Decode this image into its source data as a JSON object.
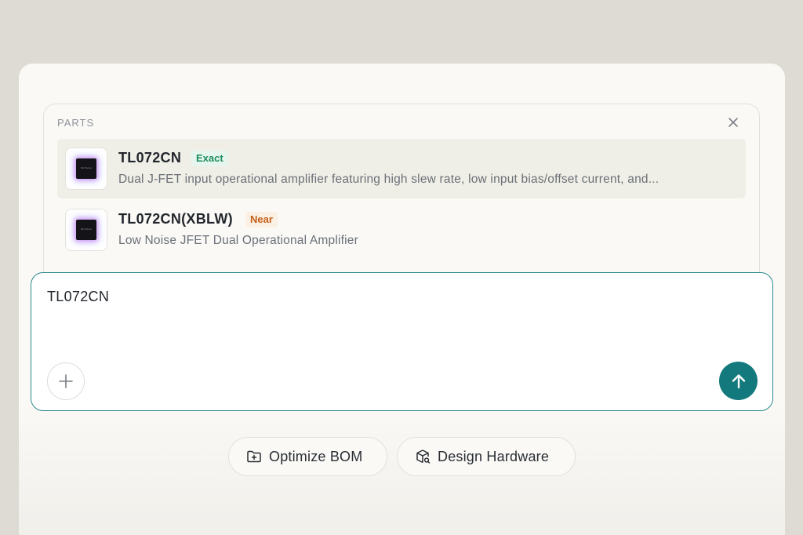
{
  "parts_panel": {
    "header": "PARTS",
    "close_icon": "close-icon",
    "items": [
      {
        "name": "TL072CN",
        "badge": "Exact",
        "badge_color": "#1e8e60",
        "description": "Dual J-FET input operational amplifier featuring high slew rate, low input bias/offset current, and...",
        "thumb_text": "PartSenia",
        "selected": true
      },
      {
        "name": "TL072CN(XBLW)",
        "badge": "Near",
        "badge_color": "#c45f1a",
        "description": "Low Noise JFET Dual Operational Amplifier",
        "thumb_text": "PartSenia",
        "selected": false
      }
    ]
  },
  "composer": {
    "value": "TL072CN",
    "add_icon": "plus-icon",
    "send_icon": "arrow-up-icon",
    "accent": "#13797d"
  },
  "actions": [
    {
      "label": "Optimize BOM",
      "icon": "folder-plus-icon"
    },
    {
      "label": "Design Hardware",
      "icon": "package-search-icon"
    }
  ]
}
